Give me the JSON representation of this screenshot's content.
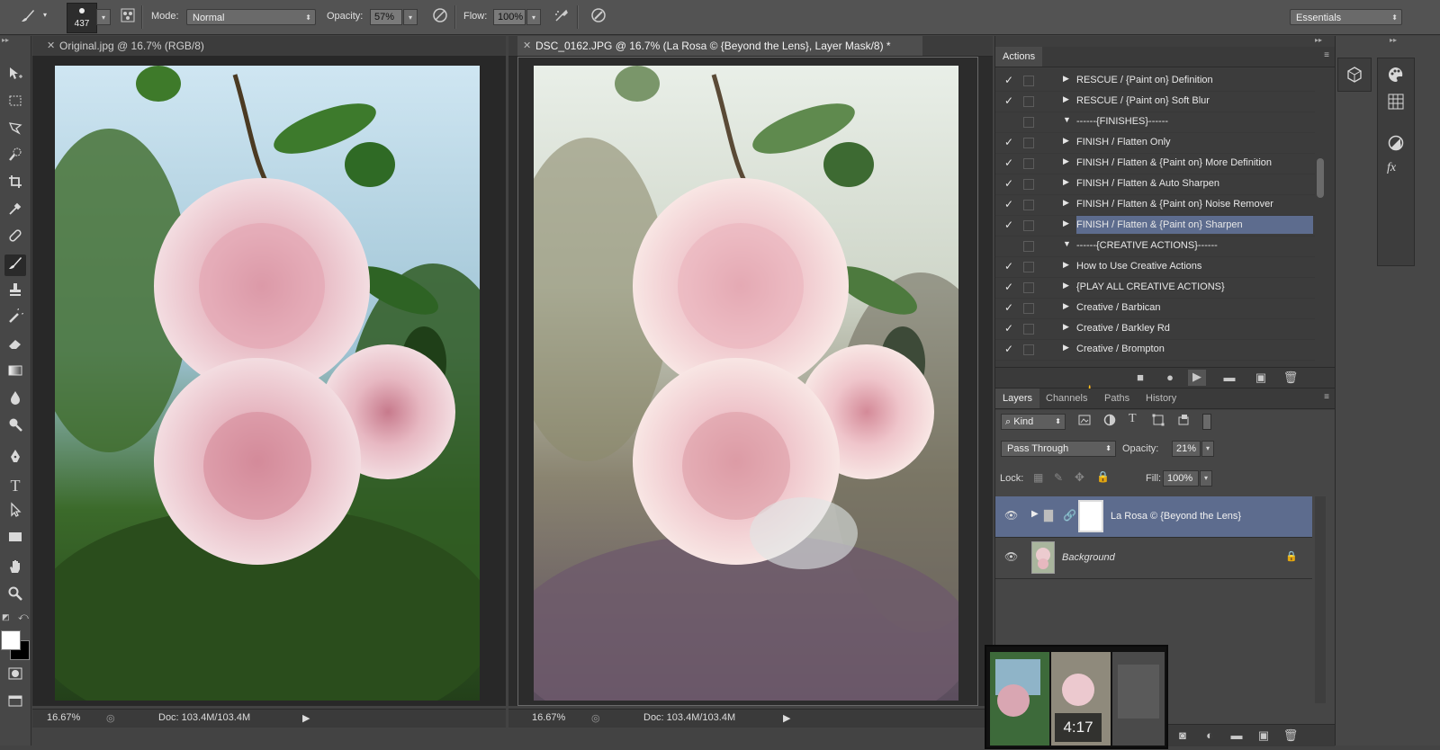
{
  "options_bar": {
    "brush_size": "437",
    "mode_label": "Mode:",
    "mode_value": "Normal",
    "opacity_label": "Opacity:",
    "opacity_value": "57%",
    "flow_label": "Flow:",
    "flow_value": "100%",
    "workspace": "Essentials"
  },
  "documents": [
    {
      "tab": "Original.jpg @ 16.7% (RGB/8)",
      "zoom": "16.67%",
      "doc": "Doc: 103.4M/103.4M",
      "active": false
    },
    {
      "tab": "DSC_0162.JPG @ 16.7% (La Rosa © {Beyond the Lens}, Layer Mask/8) *",
      "zoom": "16.67%",
      "doc": "Doc: 103.4M/103.4M",
      "active": true
    }
  ],
  "actions_panel": {
    "title": "Actions",
    "rows": [
      {
        "check": "✓",
        "name": "RESCUE / {Paint on} Definition",
        "expand": "right",
        "selected": false
      },
      {
        "check": "✓",
        "name": "RESCUE / {Paint on} Soft Blur",
        "expand": "right",
        "selected": false
      },
      {
        "check": "",
        "name": "------{FINISHES}------",
        "expand": "down",
        "selected": false
      },
      {
        "check": "✓",
        "name": "FINISH / Flatten Only",
        "expand": "right",
        "selected": false
      },
      {
        "check": "✓",
        "name": "FINISH / Flatten & {Paint on} More Definition",
        "expand": "right",
        "selected": false
      },
      {
        "check": "✓",
        "name": "FINISH / Flatten & Auto Sharpen",
        "expand": "right",
        "selected": false
      },
      {
        "check": "✓",
        "name": "FINISH / Flatten & {Paint on} Noise Remover",
        "expand": "right",
        "selected": false
      },
      {
        "check": "✓",
        "name": "FINISH / Flatten & {Paint on} Sharpen",
        "expand": "right",
        "selected": true
      },
      {
        "check": "",
        "name": "------{CREATIVE ACTIONS}------",
        "expand": "down",
        "selected": false
      },
      {
        "check": "✓",
        "name": "How to Use Creative Actions",
        "expand": "right",
        "selected": false
      },
      {
        "check": "✓",
        "name": "{PLAY ALL CREATIVE ACTIONS}",
        "expand": "right",
        "selected": false
      },
      {
        "check": "✓",
        "name": "Creative / Barbican",
        "expand": "right",
        "selected": false
      },
      {
        "check": "✓",
        "name": "Creative / Barkley Rd",
        "expand": "right",
        "selected": false
      },
      {
        "check": "✓",
        "name": "Creative / Brompton",
        "expand": "right",
        "selected": false
      }
    ]
  },
  "layers_panel": {
    "tabs": [
      "Layers",
      "Channels",
      "Paths",
      "History"
    ],
    "filter_kind": "Kind",
    "blend_mode": "Pass Through",
    "opacity_label": "Opacity:",
    "opacity_value": "21%",
    "lock_label": "Lock:",
    "fill_label": "Fill:",
    "fill_value": "100%",
    "layers": [
      {
        "name": "La Rosa © {Beyond the Lens}",
        "type": "group",
        "selected": true
      },
      {
        "name": "Background",
        "type": "background",
        "selected": false
      }
    ]
  },
  "video_thumb": {
    "time": "4:17"
  }
}
